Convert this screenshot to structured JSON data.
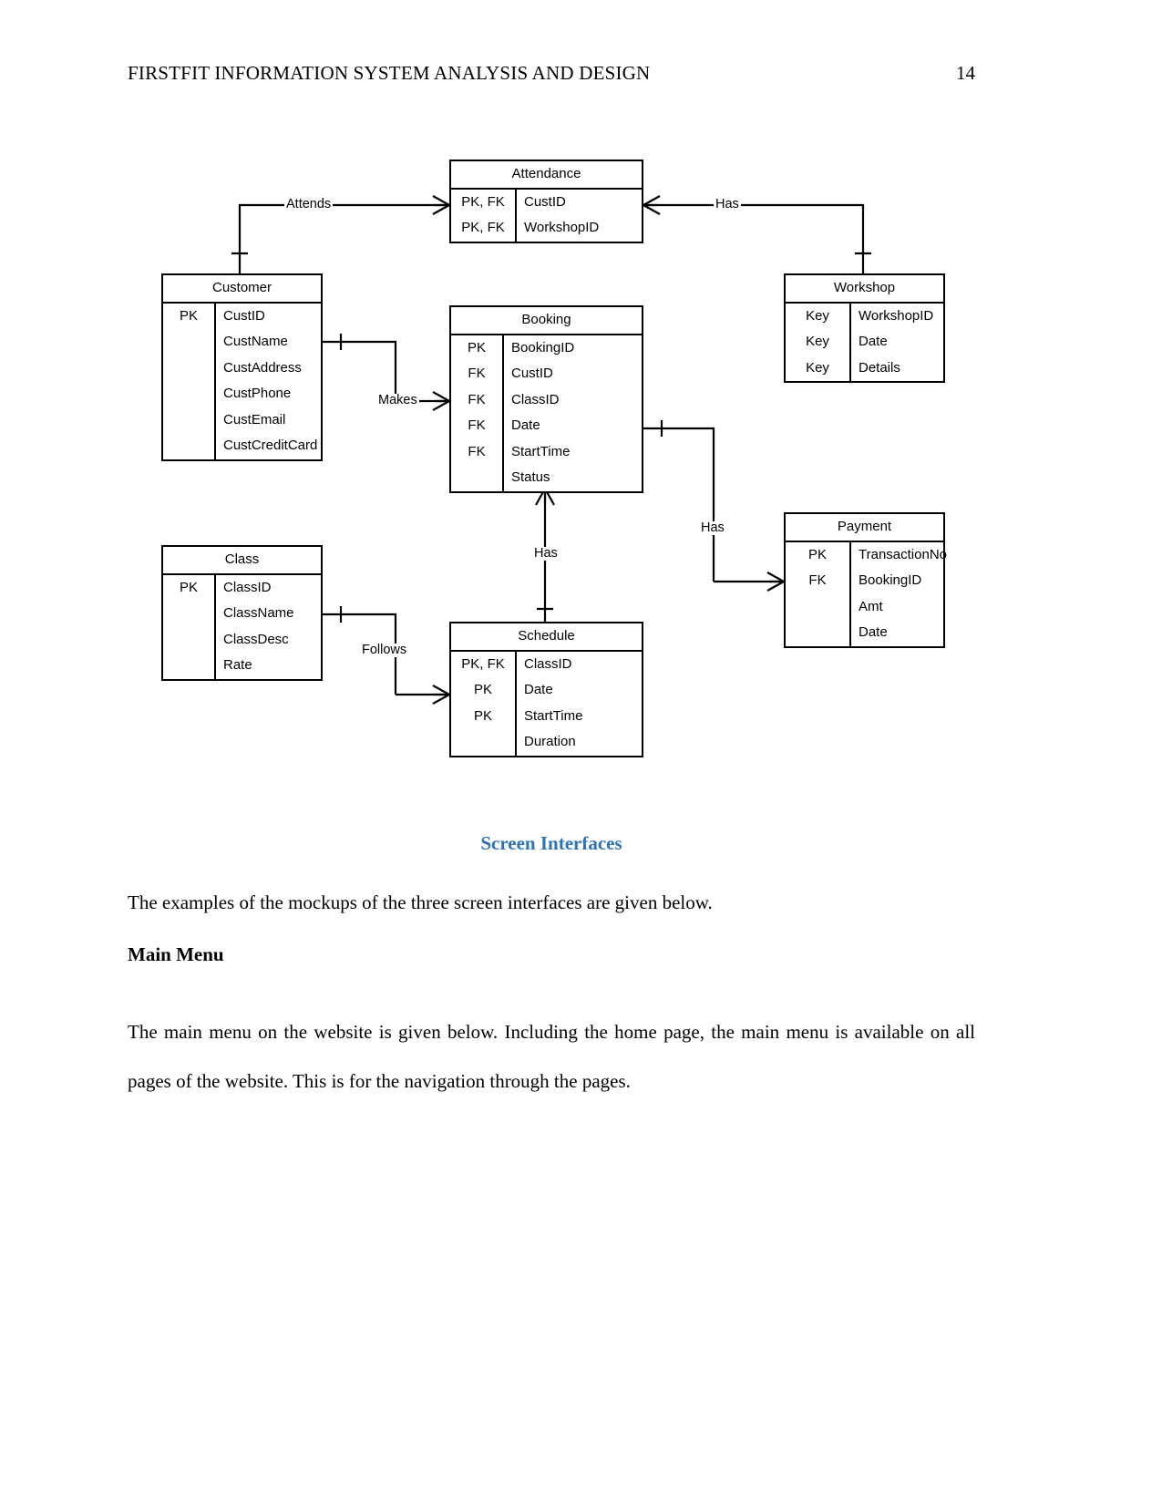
{
  "header": {
    "title": "FIRSTFIT INFORMATION SYSTEM ANALYSIS AND DESIGN",
    "page_number": "14"
  },
  "diagram": {
    "type": "entity-relationship-diagram",
    "entities": [
      {
        "id": "attendance",
        "name": "Attendance",
        "attributes": [
          {
            "key": "PK, FK",
            "name": "CustID"
          },
          {
            "key": "PK, FK",
            "name": "WorkshopID"
          }
        ]
      },
      {
        "id": "customer",
        "name": "Customer",
        "attributes": [
          {
            "key": "PK",
            "name": "CustID"
          },
          {
            "key": "",
            "name": "CustName"
          },
          {
            "key": "",
            "name": "CustAddress"
          },
          {
            "key": "",
            "name": "CustPhone"
          },
          {
            "key": "",
            "name": "CustEmail"
          },
          {
            "key": "",
            "name": "CustCreditCard"
          }
        ]
      },
      {
        "id": "booking",
        "name": "Booking",
        "attributes": [
          {
            "key": "PK",
            "name": "BookingID"
          },
          {
            "key": "FK",
            "name": "CustID"
          },
          {
            "key": "FK",
            "name": "ClassID"
          },
          {
            "key": "FK",
            "name": "Date"
          },
          {
            "key": "FK",
            "name": "StartTime"
          },
          {
            "key": "",
            "name": "Status"
          }
        ]
      },
      {
        "id": "workshop",
        "name": "Workshop",
        "attributes": [
          {
            "key": "Key",
            "name": "WorkshopID"
          },
          {
            "key": "Key",
            "name": "Date"
          },
          {
            "key": "Key",
            "name": "Details"
          }
        ]
      },
      {
        "id": "payment",
        "name": "Payment",
        "attributes": [
          {
            "key": "PK",
            "name": "TransactionNo"
          },
          {
            "key": "FK",
            "name": "BookingID"
          },
          {
            "key": "",
            "name": "Amt"
          },
          {
            "key": "",
            "name": "Date"
          }
        ]
      },
      {
        "id": "class",
        "name": "Class",
        "attributes": [
          {
            "key": "PK",
            "name": "ClassID"
          },
          {
            "key": "",
            "name": "ClassName"
          },
          {
            "key": "",
            "name": "ClassDesc"
          },
          {
            "key": "",
            "name": "Rate"
          }
        ]
      },
      {
        "id": "schedule",
        "name": "Schedule",
        "attributes": [
          {
            "key": "PK, FK",
            "name": "ClassID"
          },
          {
            "key": "PK",
            "name": "Date"
          },
          {
            "key": "PK",
            "name": "StartTime"
          },
          {
            "key": "",
            "name": "Duration"
          }
        ]
      }
    ],
    "relationships": [
      {
        "id": "attends",
        "label": "Attends",
        "from": "customer",
        "to": "attendance"
      },
      {
        "id": "has-workshop",
        "label": "Has",
        "from": "attendance",
        "to": "workshop"
      },
      {
        "id": "makes",
        "label": "Makes",
        "from": "customer",
        "to": "booking"
      },
      {
        "id": "has-schedule",
        "label": "Has",
        "from": "booking",
        "to": "schedule"
      },
      {
        "id": "has-payment",
        "label": "Has",
        "from": "booking",
        "to": "payment"
      },
      {
        "id": "follows",
        "label": "Follows",
        "from": "class",
        "to": "schedule"
      }
    ]
  },
  "body": {
    "section_heading": "Screen Interfaces",
    "section_heading_color": "#2E74B5",
    "paragraph_1": "The examples of the mockups of the three screen interfaces are given below.",
    "sub_heading": "Main Menu",
    "paragraph_2": "The main menu on the website is given below. Including the home page, the main menu is available on all pages of the website. This is for the navigation through the pages."
  }
}
